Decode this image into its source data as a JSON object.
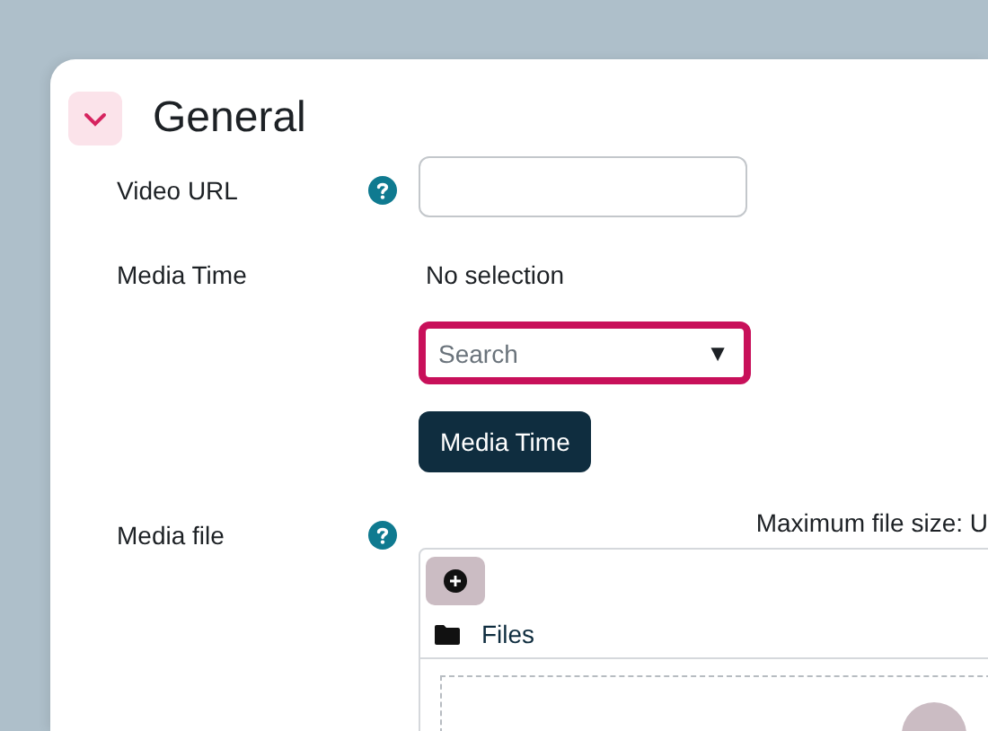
{
  "section": {
    "title": "General",
    "expanded": true
  },
  "fields": [
    {
      "kind": "text",
      "label": "Video URL",
      "help": true
    },
    {
      "kind": "media_time",
      "label": "Media Time",
      "help": false,
      "status": "No selection",
      "select": {
        "placeholder": "Search",
        "caret": "▼",
        "focused": true
      },
      "button": "Media Time"
    },
    {
      "kind": "filepicker",
      "label": "Media file",
      "help": true,
      "max_size": "Maximum file size: U",
      "folder": "Files"
    }
  ]
}
